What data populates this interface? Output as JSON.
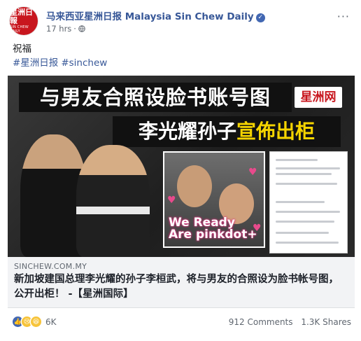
{
  "post": {
    "page_name": "马来西亚星洲日报 Malaysia Sin Chew Daily",
    "avatar_text_top": "星洲日報",
    "avatar_text_bottom": "SIN CHEW DAILY",
    "time": "17 hrs",
    "privacy_icon": "globe-icon",
    "text": "祝福",
    "hashtags": [
      "#星洲日报",
      "#sinchew"
    ]
  },
  "image": {
    "headline_1": "与男友合照设脸书账号图",
    "brand": "星洲网",
    "headline_2_a": "李光耀孙子",
    "headline_2_b": "宣佈出柜",
    "overlay": "We Ready\nAre pinkdot+"
  },
  "link": {
    "domain": "SINCHEW.COM.MY",
    "title": "新加坡建国总理李光耀的孙子李桓武，将与男友的合照设为脸书帐号图，公开出柜！ -【星洲国际】"
  },
  "engagement": {
    "reactions": [
      "like-icon",
      "sad-icon",
      "haha-icon"
    ],
    "reaction_count": "6K",
    "comments": "912 Comments",
    "shares": "1.3K Shares"
  },
  "colors": {
    "link_blue": "#385898",
    "brand_red": "#c8161e",
    "like_blue": "#4267b2",
    "headline_yellow": "#f5d400"
  }
}
